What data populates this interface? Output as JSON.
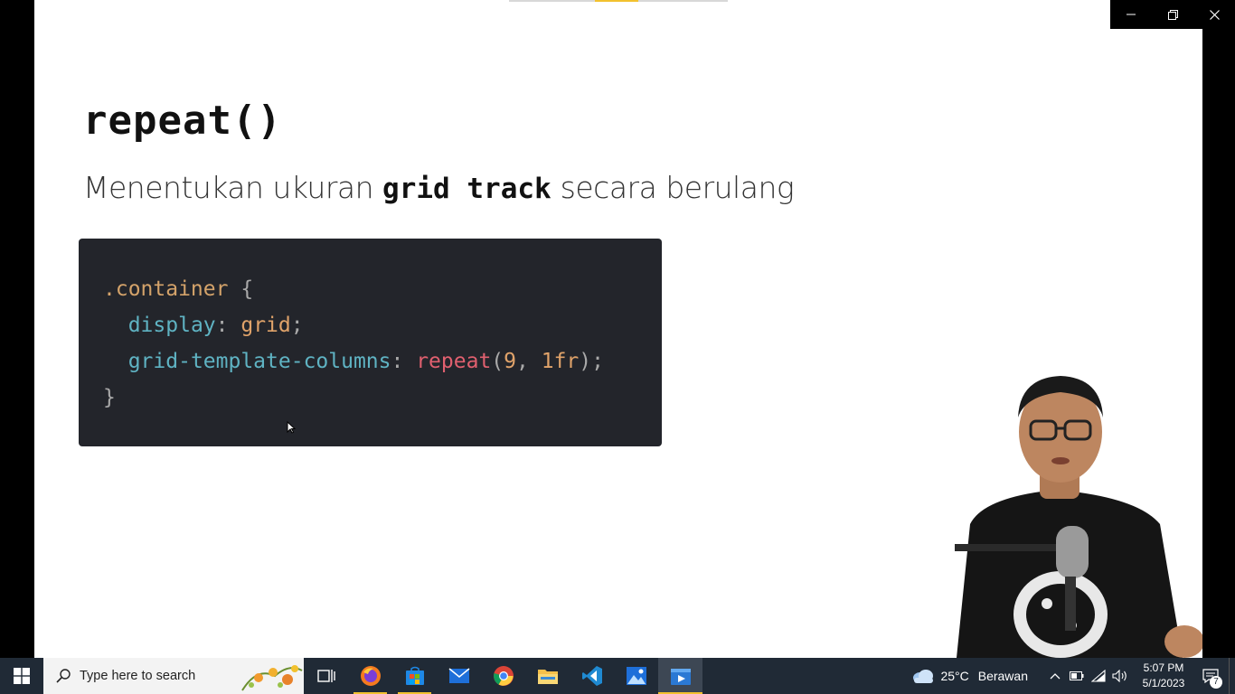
{
  "slide": {
    "title": "repeat()",
    "subtitle_pre": "Menentukan ukuran ",
    "subtitle_keyword": "grid track",
    "subtitle_post": " secara berulang",
    "code": {
      "selector": ".container",
      "open_brace": "{",
      "prop1": "display",
      "val1": "grid",
      "prop2": "grid-template-columns",
      "fn": "repeat",
      "args_open": "(",
      "arg1": "9",
      "sep": ", ",
      "arg2": "1fr",
      "args_close": ")",
      "colon": ": ",
      "semi": ";",
      "close_brace": "}"
    }
  },
  "window_controls": {
    "icons": [
      "minimize-icon",
      "restore-icon",
      "close-icon"
    ]
  },
  "taskbar": {
    "search_placeholder": "Type here to search",
    "apps": [
      {
        "name": "task-view",
        "icon": "task-view-icon"
      },
      {
        "name": "firefox",
        "icon": "firefox-icon"
      },
      {
        "name": "microsoft-store",
        "icon": "store-icon"
      },
      {
        "name": "mail",
        "icon": "mail-icon"
      },
      {
        "name": "chrome",
        "icon": "chrome-icon"
      },
      {
        "name": "file-explorer",
        "icon": "folder-icon"
      },
      {
        "name": "vscode",
        "icon": "vscode-icon"
      },
      {
        "name": "photos",
        "icon": "photos-icon"
      },
      {
        "name": "media-player",
        "icon": "media-player-icon"
      }
    ],
    "weather": {
      "temp": "25°C",
      "condition": "Berawan"
    },
    "clock": {
      "time": "5:07 PM",
      "date": "5/1/2023"
    },
    "notification_count": "7"
  },
  "colors": {
    "taskbar_bg": "#202a36",
    "code_bg": "#23252b",
    "accent": "#f2c12e"
  }
}
